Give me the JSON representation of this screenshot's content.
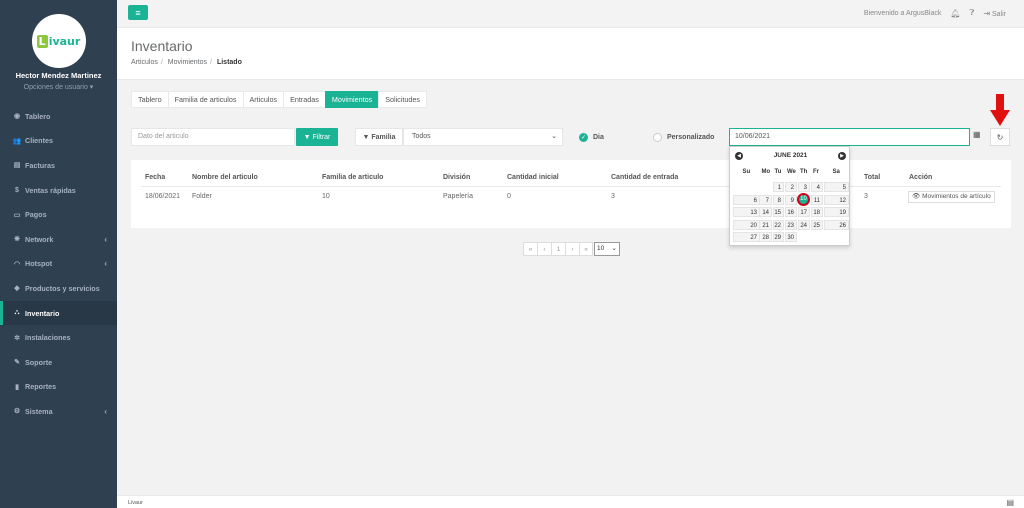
{
  "sidebar": {
    "logo": {
      "mark": "L",
      "text": "ivaur"
    },
    "user_name": "Hector Mendez Martinez",
    "user_options": "Opciones de usuario ▾",
    "items": [
      {
        "label": "Tablero",
        "icon": "dashboard-icon",
        "glyph": "◉",
        "active": false,
        "expand": false
      },
      {
        "label": "Clientes",
        "icon": "users-icon",
        "glyph": "👥",
        "active": false,
        "expand": false
      },
      {
        "label": "Facturas",
        "icon": "invoice-icon",
        "glyph": "▤",
        "active": false,
        "expand": false
      },
      {
        "label": "Ventas rápidas",
        "icon": "dollar-icon",
        "glyph": "$",
        "active": false,
        "expand": false
      },
      {
        "label": "Pagos",
        "icon": "money-icon",
        "glyph": "▭",
        "active": false,
        "expand": false
      },
      {
        "label": "Network",
        "icon": "network-icon",
        "glyph": "❋",
        "active": false,
        "expand": true
      },
      {
        "label": "Hotspot",
        "icon": "wifi-icon",
        "glyph": "◠",
        "active": false,
        "expand": true
      },
      {
        "label": "Productos y servicios",
        "icon": "tag-icon",
        "glyph": "◆",
        "active": false,
        "expand": false
      },
      {
        "label": "Inventario",
        "icon": "cubes-icon",
        "glyph": "⛬",
        "active": true,
        "expand": false
      },
      {
        "label": "Instalaciones",
        "icon": "gears-icon",
        "glyph": "✲",
        "active": false,
        "expand": false
      },
      {
        "label": "Soporte",
        "icon": "wrench-icon",
        "glyph": "✎",
        "active": false,
        "expand": false
      },
      {
        "label": "Reportes",
        "icon": "book-icon",
        "glyph": "▮",
        "active": false,
        "expand": false
      },
      {
        "label": "Sistema",
        "icon": "cogs-icon",
        "glyph": "⚙",
        "active": false,
        "expand": true
      }
    ]
  },
  "topbar": {
    "welcome": "Bienvenido a ArgusBlack",
    "logout": "Salir"
  },
  "heading": {
    "title": "Inventario",
    "breadcrumb": [
      "Articulos",
      "Movimientos",
      "Listado"
    ]
  },
  "tabs": [
    {
      "label": "Tablero",
      "active": false
    },
    {
      "label": "Familia de articulos",
      "active": false
    },
    {
      "label": "Articulos",
      "active": false
    },
    {
      "label": "Entradas",
      "active": false
    },
    {
      "label": "Movimientos",
      "active": true
    },
    {
      "label": "Solicitudes",
      "active": false
    }
  ],
  "filters": {
    "article_placeholder": "Dato del articulo",
    "filter_button": "Filtrar",
    "familia_label": "Familia",
    "familia_value": "Todos",
    "radio_dia": "Dia",
    "radio_personalizado": "Personalizado",
    "date_value": "10/06/2021"
  },
  "table": {
    "headers": [
      "Fecha",
      "Nombre del articulo",
      "Familia de articulo",
      "División",
      "Cantidad inicial",
      "Cantidad de entrada",
      "Total",
      "Acción"
    ],
    "rows": [
      {
        "fecha": "18/06/2021",
        "nombre": "Folder",
        "familia": "10",
        "division": "Papelería",
        "inicial": "0",
        "entrada": "3",
        "total": "3",
        "accion": "Movimientos de artículo"
      }
    ]
  },
  "pagination": {
    "buttons": [
      "«",
      "‹",
      "1",
      "›",
      "»"
    ],
    "page_size": "10"
  },
  "datepicker": {
    "month_title": "JUNE 2021",
    "days_of_week": [
      "Su",
      "Mo",
      "Tu",
      "We",
      "Th",
      "Fr",
      "Sa"
    ],
    "weeks": [
      [
        "",
        "",
        "1",
        "2",
        "3",
        "4",
        "5"
      ],
      [
        "6",
        "7",
        "8",
        "9",
        "10",
        "11",
        "12"
      ],
      [
        "13",
        "14",
        "15",
        "16",
        "17",
        "18",
        "19"
      ],
      [
        "20",
        "21",
        "22",
        "23",
        "24",
        "25",
        "26"
      ],
      [
        "27",
        "28",
        "29",
        "30",
        "",
        "",
        ""
      ]
    ],
    "selected_day": "10"
  },
  "footer": {
    "text": "Livaur"
  },
  "colors": {
    "accent": "#1ab394",
    "sidebar": "#2f4050",
    "annotation_arrow": "#e01010"
  }
}
